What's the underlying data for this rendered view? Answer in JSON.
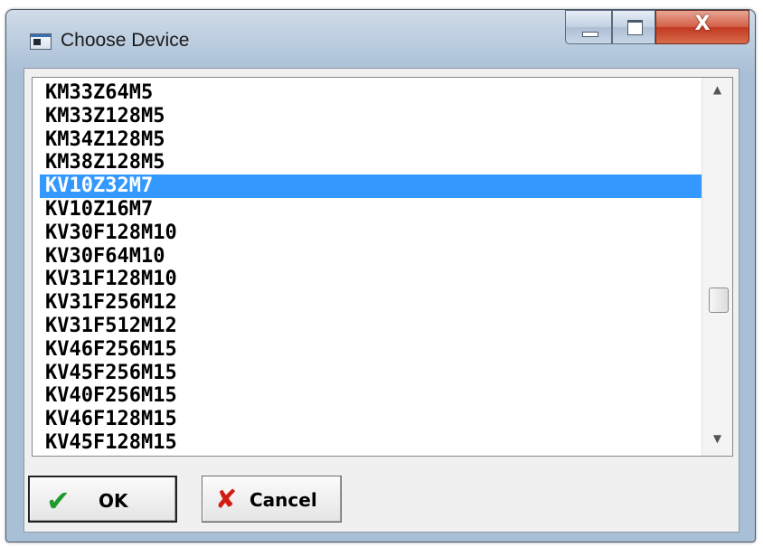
{
  "window": {
    "title": "Choose Device",
    "icon": "app-window-icon",
    "close_glyph": "X"
  },
  "device_list": {
    "items": [
      "KM33Z64M5",
      "KM33Z128M5",
      "KM34Z128M5",
      "KM38Z128M5",
      "KV10Z32M7",
      "KV10Z16M7",
      "KV30F128M10",
      "KV30F64M10",
      "KV31F128M10",
      "KV31F256M12",
      "KV31F512M12",
      "KV46F256M15",
      "KV45F256M15",
      "KV40F256M15",
      "KV46F128M15",
      "KV45F128M15"
    ],
    "selected": "KV10Z32M7"
  },
  "buttons": {
    "ok_label": "OK",
    "ok_icon": "checkmark-icon",
    "cancel_label": "Cancel",
    "cancel_icon": "x-cross-icon"
  },
  "colors": {
    "selection": "#3399ff",
    "ok_icon": "#1f9a2b",
    "cancel_icon": "#d11c14"
  }
}
